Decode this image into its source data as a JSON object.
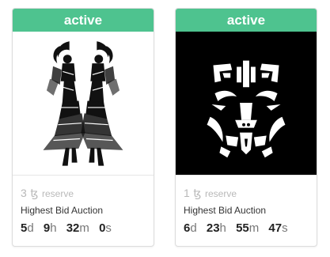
{
  "auctions": [
    {
      "status": "active",
      "reserve": {
        "amount": "3",
        "currency_symbol": "ꜩ",
        "label": "reserve"
      },
      "auction_type": "Highest Bid Auction",
      "countdown": [
        {
          "value": "5",
          "unit": "d"
        },
        {
          "value": "9",
          "unit": "h"
        },
        {
          "value": "32",
          "unit": "m"
        },
        {
          "value": "0",
          "unit": "s"
        }
      ],
      "artwork_icon": "mirrored-dancers-artwork"
    },
    {
      "status": "active",
      "reserve": {
        "amount": "1",
        "currency_symbol": "ꜩ",
        "label": "reserve"
      },
      "auction_type": "Highest Bid Auction",
      "countdown": [
        {
          "value": "6",
          "unit": "d"
        },
        {
          "value": "23",
          "unit": "h"
        },
        {
          "value": "55",
          "unit": "m"
        },
        {
          "value": "47",
          "unit": "s"
        }
      ],
      "artwork_icon": "tribal-mask-artwork"
    }
  ],
  "colors": {
    "status_active": "#4ec38f",
    "reserve_text": "#b9b9b9",
    "timer_value": "#222222",
    "timer_unit": "#777777"
  }
}
